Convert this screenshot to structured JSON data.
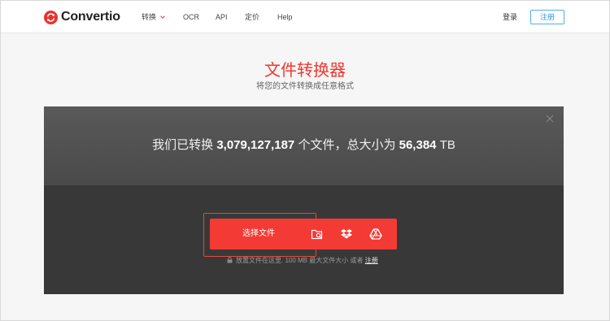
{
  "header": {
    "brand": "Convertio",
    "nav": [
      {
        "label": "转换",
        "has_caret": true
      },
      {
        "label": "OCR"
      },
      {
        "label": "API"
      },
      {
        "label": "定价"
      },
      {
        "label": "Help"
      }
    ],
    "login_label": "登录",
    "signup_label": "注册"
  },
  "hero": {
    "title": "文件转换器",
    "subtitle": "将您的文件转换成任意格式"
  },
  "panel": {
    "stats_prefix": "我们已转换",
    "files_count": "3,079,127,187",
    "stats_middle": "个文件，总大小为",
    "total_size": "56,384",
    "size_unit": "TB",
    "choose_label": "选择文件",
    "sources": [
      {
        "icon": "folder-search-icon"
      },
      {
        "icon": "dropbox-icon"
      },
      {
        "icon": "google-drive-icon"
      }
    ],
    "hint_text": "放置文件在这里. 100 MB 最大文件大小 或者",
    "hint_link": "注册"
  },
  "colors": {
    "brand_red": "#f33a35",
    "title_red": "#f0372f",
    "signup_blue": "#2d9be0",
    "panel_dark": "#383838"
  }
}
